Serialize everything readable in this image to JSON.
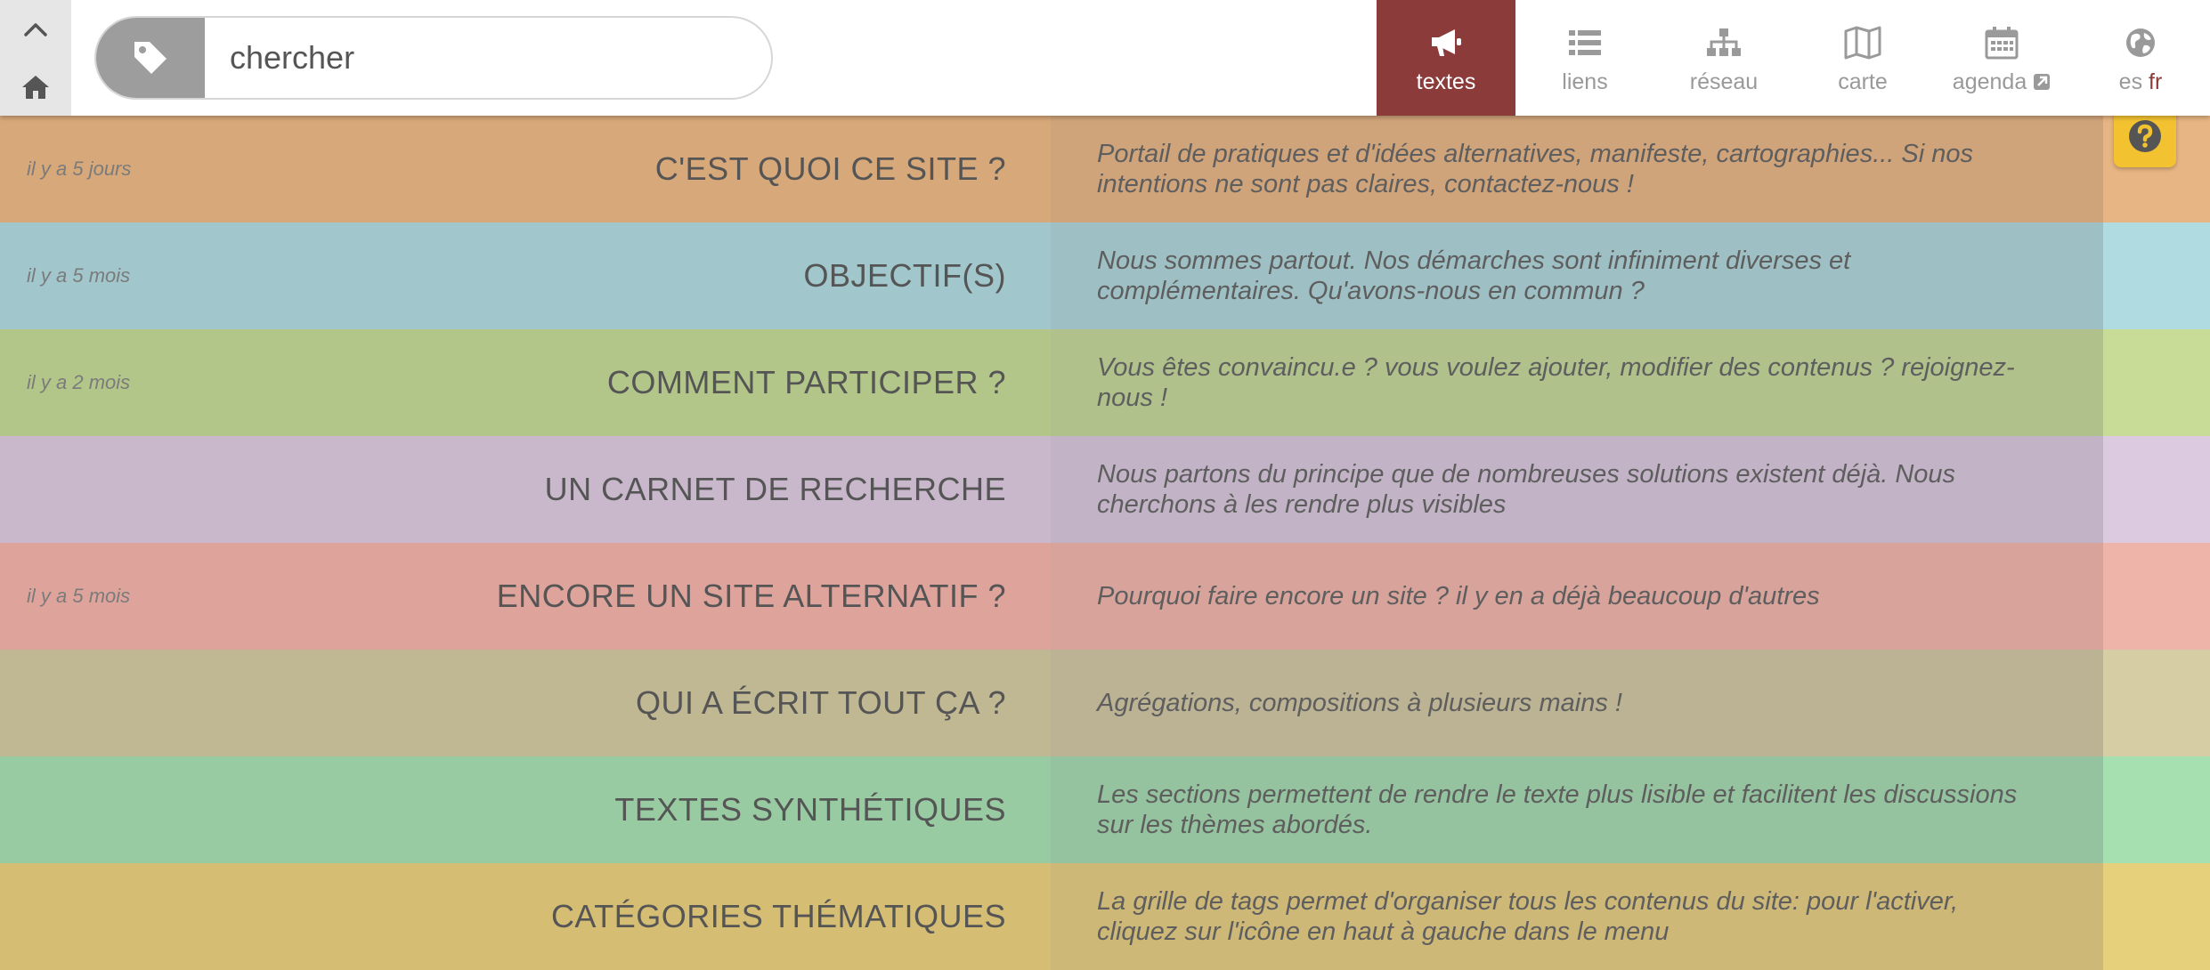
{
  "search": {
    "placeholder": "chercher"
  },
  "nav": {
    "items": [
      {
        "label": "textes",
        "icon": "megaphone-icon",
        "active": true
      },
      {
        "label": "liens",
        "icon": "list-icon"
      },
      {
        "label": "réseau",
        "icon": "sitemap-icon"
      },
      {
        "label": "carte",
        "icon": "map-icon"
      },
      {
        "label": "agenda",
        "icon": "calendar-icon",
        "external": true
      }
    ],
    "languages": {
      "unselected": "es",
      "selected": "fr"
    }
  },
  "colors": {
    "active_nav": "#8c3b3b",
    "help_button": "#f2c230"
  },
  "rows": [
    {
      "date": "il y a 5 jours",
      "title": "C'EST QUOI CE SITE ?",
      "desc": "Portail de pratiques et d'idées alternatives, manifeste, cartographies... Si nos intentions ne sont pas claires, contactez-nous !",
      "colors": {
        "left": "#d7a879",
        "mid": "#d0a47a",
        "right": "#e7b583"
      }
    },
    {
      "date": "il y a 5 mois",
      "title": "OBJECTIF(S)",
      "desc": "Nous sommes partout. Nos démarches sont infiniment diverses et complémentaires. Qu'avons-nous en commun ?",
      "colors": {
        "left": "#a1c6cb",
        "mid": "#9ec0c4",
        "right": "#b0dbe0"
      }
    },
    {
      "date": "il y a 2 mois",
      "title": "COMMENT PARTICIPER ?",
      "desc": "Vous êtes convaincu.e ? vous voulez ajouter, modifier des contenus ? rejoignez-nous !",
      "colors": {
        "left": "#b3c68a",
        "mid": "#b0c18b",
        "right": "#c8dc98"
      }
    },
    {
      "date": "",
      "title": "UN CARNET DE RECHERCHE",
      "desc": "Nous partons du principe que de nombreuses solutions existent déjà. Nous cherchons à les rendre plus visibles",
      "colors": {
        "left": "#c9b8cc",
        "mid": "#c2b3c6",
        "right": "#dccbe0"
      }
    },
    {
      "date": "il y a 5 mois",
      "title": "ENCORE UN SITE ALTERNATIF ?",
      "desc": "Pourquoi faire encore un site ? il y en a déjà beaucoup d'autres",
      "colors": {
        "left": "#dea49b",
        "mid": "#d7a39b",
        "right": "#eeb4a9"
      }
    },
    {
      "date": "",
      "title": "QUI A ÉCRIT TOUT ÇA ?",
      "desc": "Agrégations, compositions à plusieurs mains !",
      "colors": {
        "left": "#c0b793",
        "mid": "#bcb394",
        "right": "#d6cda5"
      }
    },
    {
      "date": "",
      "title": "TEXTES SYNTHÉTIQUES",
      "desc": "Les sections permettent de rendre le texte plus lisible et facilitent les discussions sur les thèmes abordés.",
      "colors": {
        "left": "#98cba2",
        "mid": "#95c29f",
        "right": "#a6e0b0"
      }
    },
    {
      "date": "",
      "title": "CATÉGORIES THÉMATIQUES",
      "desc": "La grille de tags permet d'organiser tous les contenus du site: pour l'activer, cliquez sur l'icône en haut à gauche dans le menu",
      "colors": {
        "left": "#d5be74",
        "mid": "#cdb878",
        "right": "#e6d07c"
      }
    }
  ]
}
